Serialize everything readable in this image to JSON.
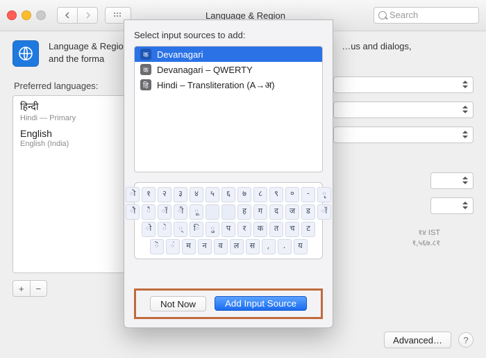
{
  "window": {
    "title": "Language & Region"
  },
  "toolbar": {
    "search_placeholder": "Search"
  },
  "header": {
    "desc_line1": "Language & Region",
    "desc_line1_tail": "…us and dialogs,",
    "desc_line2": "and the forma"
  },
  "left": {
    "label": "Preferred languages:",
    "items": [
      {
        "name": "हिन्दी",
        "sub": "Hindi — Primary"
      },
      {
        "name": "English",
        "sub": "English (India)"
      }
    ],
    "plus": "+",
    "minus": "−"
  },
  "right_info": {
    "line1": "१४ IST",
    "line2": "१,५६७.८१"
  },
  "footer": {
    "advanced": "Advanced…",
    "help": "?"
  },
  "sheet": {
    "prompt": "Select input sources to add:",
    "sources": [
      {
        "icon": "क",
        "label": "Devanagari",
        "selected": true
      },
      {
        "icon": "क",
        "label": "Devanagari – QWERTY",
        "selected": false
      },
      {
        "icon": "हि",
        "label": "Hindi – Transliteration (A→अ)",
        "selected": false
      }
    ],
    "keyboard": {
      "row1": [
        "ॊ",
        "१",
        "२",
        "३",
        "४",
        "५",
        "६",
        "७",
        "८",
        "९",
        "०",
        "-",
        "ृ"
      ],
      "row2": [
        "ौ",
        "ै",
        "ॉ",
        "ी",
        "ू",
        "",
        "",
        "ह",
        "ग",
        "द",
        "ज",
        "ड",
        "ॉ"
      ],
      "row3": [
        "ो",
        "े",
        "्",
        "ि",
        "ु",
        "प",
        "र",
        "क",
        "त",
        "च",
        "ट"
      ],
      "row4": [
        "ॆ",
        "ं",
        "म",
        "न",
        "व",
        "ल",
        "स",
        ",",
        ".",
        "य"
      ]
    },
    "not_now": "Not Now",
    "add": "Add Input Source"
  }
}
